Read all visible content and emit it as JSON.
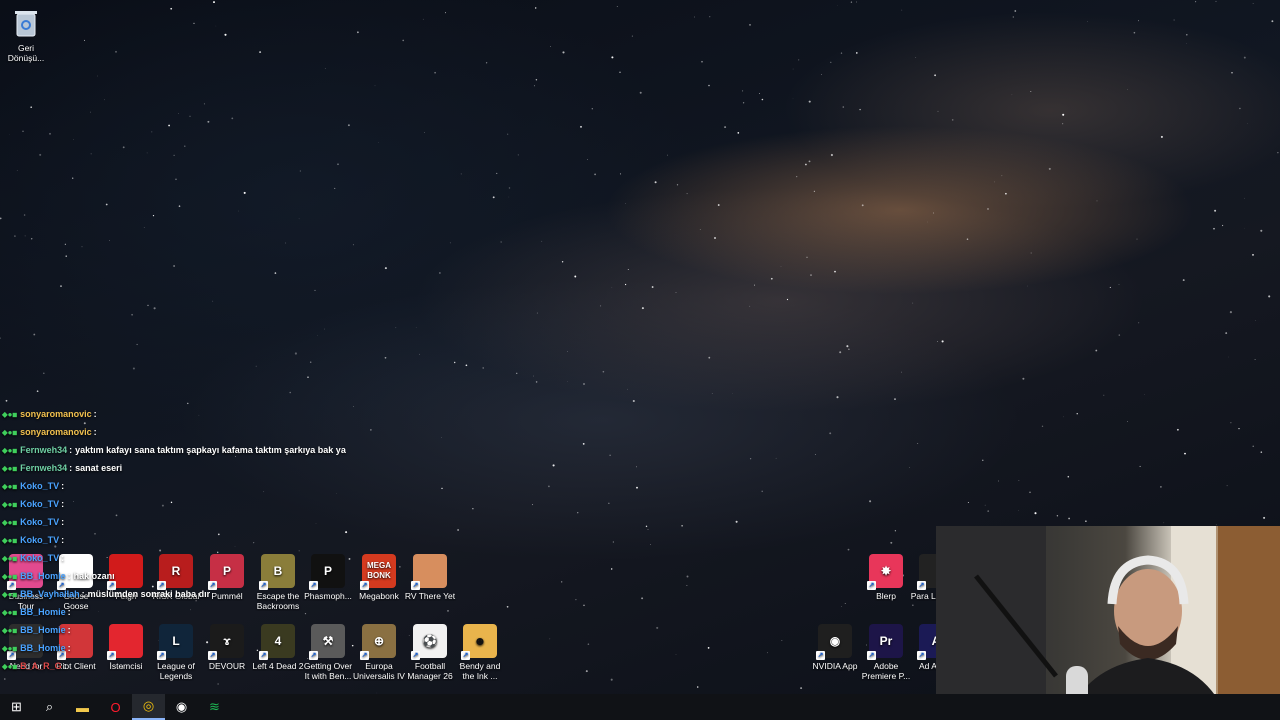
{
  "desktop": {
    "recycle_bin": {
      "label": "Geri Dönüşü...",
      "icon": "recycle-bin-icon"
    },
    "left_row1": [
      {
        "label": "Business Tour",
        "color": "#e24a8f",
        "glyph": "",
        "icon": "business-tour-icon"
      },
      {
        "label": "Goose Goose",
        "color": "#ffffff",
        "glyph": "",
        "icon": "goose-goose-duck-icon"
      },
      {
        "label": "Feign",
        "color": "#d11b1b",
        "glyph": "",
        "icon": "feign-icon"
      },
      {
        "label": "RISK Global",
        "color": "#b81d1d",
        "glyph": "R",
        "icon": "risk-global-icon"
      },
      {
        "label": "Pummel",
        "color": "#c62f45",
        "glyph": "P",
        "icon": "pummel-party-icon"
      },
      {
        "label": "Escape the Backrooms",
        "color": "#8a7d3a",
        "glyph": "B",
        "icon": "escape-backrooms-icon"
      },
      {
        "label": "Phasmoph...",
        "color": "#111111",
        "glyph": "P",
        "icon": "phasmophobia-icon"
      },
      {
        "label": "Megabonk",
        "color": "#d43a1f",
        "glyph": "MEGA BONK",
        "icon": "megabonk-icon"
      },
      {
        "label": "RV There Yet",
        "color": "#d78e5e",
        "glyph": "",
        "icon": "rv-there-yet-icon"
      }
    ],
    "left_row2": [
      {
        "label": "Need for",
        "color": "#2d2d2d",
        "glyph": "",
        "icon": "need-for-speed-icon"
      },
      {
        "label": "Riot Client",
        "color": "#d13639",
        "glyph": "",
        "icon": "riot-client-icon"
      },
      {
        "label": "İstemcisi",
        "color": "#e3262f",
        "glyph": "",
        "icon": "riot-istemcisi-icon"
      },
      {
        "label": "League of Legends",
        "color": "#10253a",
        "glyph": "L",
        "icon": "league-of-legends-icon"
      },
      {
        "label": "DEVOUR",
        "color": "#1b1b1b",
        "glyph": "ɤ",
        "icon": "devour-icon"
      },
      {
        "label": "Left 4 Dead 2",
        "color": "#3a3a20",
        "glyph": "4",
        "icon": "left4dead2-icon"
      },
      {
        "label": "Getting Over It with Ben...",
        "color": "#5a5a5a",
        "glyph": "⚒",
        "icon": "getting-over-it-icon"
      },
      {
        "label": "Europa Universalis IV",
        "color": "#8a7042",
        "glyph": "⊕",
        "icon": "europa-universalis-icon"
      },
      {
        "label": "Football Manager 26",
        "color": "#f2f2f2",
        "glyph": "⚽",
        "icon": "football-manager-icon"
      },
      {
        "label": "Bendy and the Ink ...",
        "color": "#e9b44c",
        "glyph": "☻",
        "icon": "bendy-icon"
      }
    ],
    "right_icons": [
      {
        "label": "Blerp",
        "color": "#e8365a",
        "glyph": "✸",
        "icon": "blerp-icon"
      },
      {
        "label": "Para Launc...",
        "color": "#222222",
        "glyph": "",
        "icon": "para-launcher-icon"
      },
      {
        "label": "NVIDIA App",
        "color": "#1f1f1f",
        "glyph": "◉",
        "icon": "nvidia-app-icon"
      },
      {
        "label": "Adobe Premiere P...",
        "color": "#1d1548",
        "glyph": "Pr",
        "icon": "premiere-pro-icon"
      },
      {
        "label": "Ad Auc...",
        "color": "#1b1a55",
        "glyph": "A",
        "icon": "adobe-audition-icon"
      }
    ]
  },
  "chat": [
    {
      "user": "sonyaromanovic",
      "color": "#f2c14e",
      "text": ""
    },
    {
      "user": "sonyaromanovic",
      "color": "#f2c14e",
      "text": ""
    },
    {
      "user": "Fernweh34",
      "color": "#6fd0a4",
      "text": "yaktım kafayı sana taktım şapkayı kafama taktım şarkıya bak ya"
    },
    {
      "user": "Fernweh34",
      "color": "#6fd0a4",
      "text": "sanat eseri"
    },
    {
      "user": "Koko_TV",
      "color": "#4aa3ff",
      "text": ""
    },
    {
      "user": "Koko_TV",
      "color": "#4aa3ff",
      "text": ""
    },
    {
      "user": "Koko_TV",
      "color": "#4aa3ff",
      "text": ""
    },
    {
      "user": "Koko_TV",
      "color": "#4aa3ff",
      "text": ""
    },
    {
      "user": "Koko_TV",
      "color": "#4aa3ff",
      "text": ""
    },
    {
      "user": "BB_Homie",
      "color": "#4aa3ff",
      "text": "hak ozanı"
    },
    {
      "user": "BB_Vayhallah",
      "color": "#4aa3ff",
      "text": "müslümden sonraki baba dır"
    },
    {
      "user": "BB_Homie",
      "color": "#4aa3ff",
      "text": ""
    },
    {
      "user": "BB_Homie",
      "color": "#4aa3ff",
      "text": ""
    },
    {
      "user": "BB_Homie",
      "color": "#4aa3ff",
      "text": ""
    },
    {
      "user": "B_A_R_G",
      "color": "#e04a4a",
      "text": ""
    }
  ],
  "taskbar": [
    {
      "icon": "windows-start-icon",
      "glyph": "⊞",
      "active": false
    },
    {
      "icon": "search-icon",
      "glyph": "⌕",
      "active": false
    },
    {
      "icon": "file-explorer-icon",
      "glyph": "▬",
      "active": false
    },
    {
      "icon": "opera-icon",
      "glyph": "O",
      "active": false
    },
    {
      "icon": "chrome-icon",
      "glyph": "◎",
      "active": true
    },
    {
      "icon": "obs-icon",
      "glyph": "◉",
      "active": false
    },
    {
      "icon": "spotify-icon",
      "glyph": "≋",
      "active": false
    }
  ]
}
